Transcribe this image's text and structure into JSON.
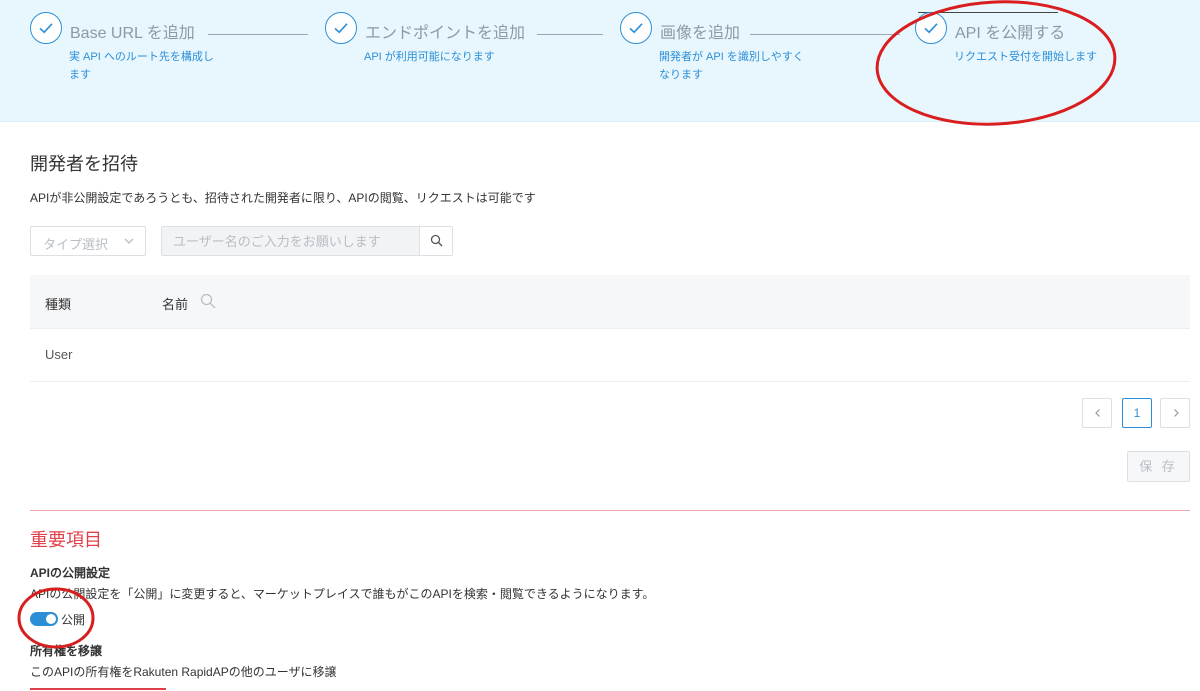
{
  "stepper": {
    "steps": [
      {
        "title": "Base URL を追加",
        "desc": "実 API へのルート先を構成します"
      },
      {
        "title": "エンドポイントを追加",
        "desc": "API が利用可能になります"
      },
      {
        "title": "画像を追加",
        "desc": "開発者が API を識別しやすくなります"
      },
      {
        "title": "API を公開する",
        "desc": "リクエスト受付を開始します"
      }
    ]
  },
  "invite": {
    "title": "開発者を招待",
    "description": "APIが非公開設定であろうとも、招待された開発者に限り、APIの閲覧、リクエストは可能です",
    "type_select": {
      "value": "タイプ選択"
    },
    "search": {
      "placeholder": "ユーザー名のご入力をお願いします"
    },
    "table": {
      "headers": [
        "種類",
        "名前"
      ],
      "rows": [
        {
          "type": "User"
        }
      ]
    },
    "pagination": {
      "current_page": "1"
    },
    "save_label": "保 存"
  },
  "important": {
    "title": "重要項目",
    "visibility": {
      "title": "APIの公開設定",
      "description": "APIの公開設定を「公開」に変更すると、マーケットプレイスで誰もがこのAPIを検索・閲覧できるようになります。",
      "toggle_label": "公開",
      "toggle_on": true
    },
    "transfer": {
      "title": "所有権を移譲",
      "description": "このAPIの所有権をRakuten RapidAPの他のユーザに移譲"
    }
  },
  "colors": {
    "accent": "#2b8fd8",
    "stepper_bg": "#e8f6fd",
    "danger": "#e0404a",
    "annotation": "#d81e1e"
  }
}
